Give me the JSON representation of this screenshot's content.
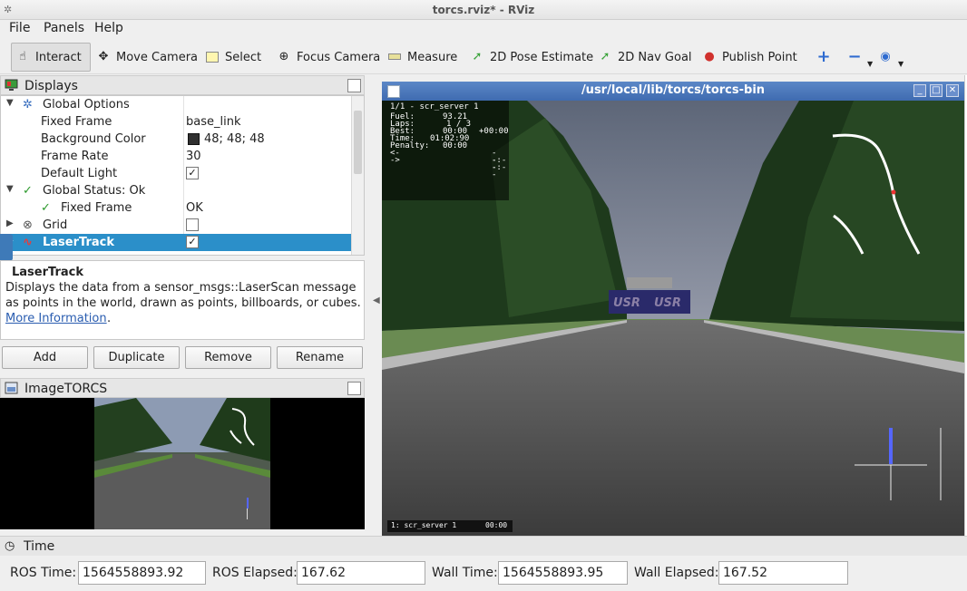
{
  "window": {
    "title": "torcs.rviz* - RViz"
  },
  "menu": {
    "file": "File",
    "panels": "Panels",
    "help": "Help"
  },
  "toolbar": {
    "interact": "Interact",
    "move_camera": "Move Camera",
    "select": "Select",
    "focus_camera": "Focus Camera",
    "measure": "Measure",
    "pose_estimate": "2D Pose Estimate",
    "nav_goal": "2D Nav Goal",
    "publish_point": "Publish Point"
  },
  "displays": {
    "title": "Displays",
    "rows": [
      {
        "label": "Global Options",
        "value": ""
      },
      {
        "label": "Fixed Frame",
        "value": "base_link"
      },
      {
        "label": "Background Color",
        "value": "48; 48; 48"
      },
      {
        "label": "Frame Rate",
        "value": "30"
      },
      {
        "label": "Default Light",
        "value": ""
      },
      {
        "label": "Global Status: Ok",
        "value": ""
      },
      {
        "label": "Fixed Frame",
        "value": "OK"
      },
      {
        "label": "Grid",
        "value": ""
      },
      {
        "label": "LaserTrack",
        "value": ""
      }
    ],
    "description_title": "LaserTrack",
    "description_text": "Displays the data from a sensor_msgs::LaserScan message as points in the world, drawn as points, billboards, or cubes.",
    "more_info": "More Information",
    "more_info_suffix": ".",
    "buttons": {
      "add": "Add",
      "duplicate": "Duplicate",
      "remove": "Remove",
      "rename": "Rename"
    },
    "bg_color": "#303030",
    "accent": "#2b8fc9"
  },
  "image_panel": {
    "title": "ImageTORCS"
  },
  "torcs_window": {
    "title": "/usr/local/lib/torcs/torcs-bin",
    "hud": {
      "header": "1/1 - scr_server 1",
      "lines": [
        {
          "k": "Fuel:",
          "v": "93.21",
          "x": ""
        },
        {
          "k": "Laps:",
          "v": "1 / 3",
          "x": ""
        },
        {
          "k": "Best:",
          "v": "00:00",
          "x": "+00:00"
        },
        {
          "k": "Time:",
          "v": "01:02:90",
          "x": ""
        },
        {
          "k": "Penalty:",
          "v": "00:00",
          "x": ""
        },
        {
          "k": "<-",
          "v": "",
          "x": "--:--"
        },
        {
          "k": "->",
          "v": "",
          "x": "--:--"
        }
      ],
      "footer_left": "1: scr_server 1",
      "footer_right": "00:00"
    },
    "banner_text": "USR"
  },
  "time_panel": {
    "title": "Time",
    "ros_time_label": "ROS Time:",
    "ros_time": "1564558893.92",
    "ros_elapsed_label": "ROS Elapsed:",
    "ros_elapsed": "167.62",
    "wall_time_label": "Wall Time:",
    "wall_time": "1564558893.95",
    "wall_elapsed_label": "Wall Elapsed:",
    "wall_elapsed": "167.52"
  }
}
